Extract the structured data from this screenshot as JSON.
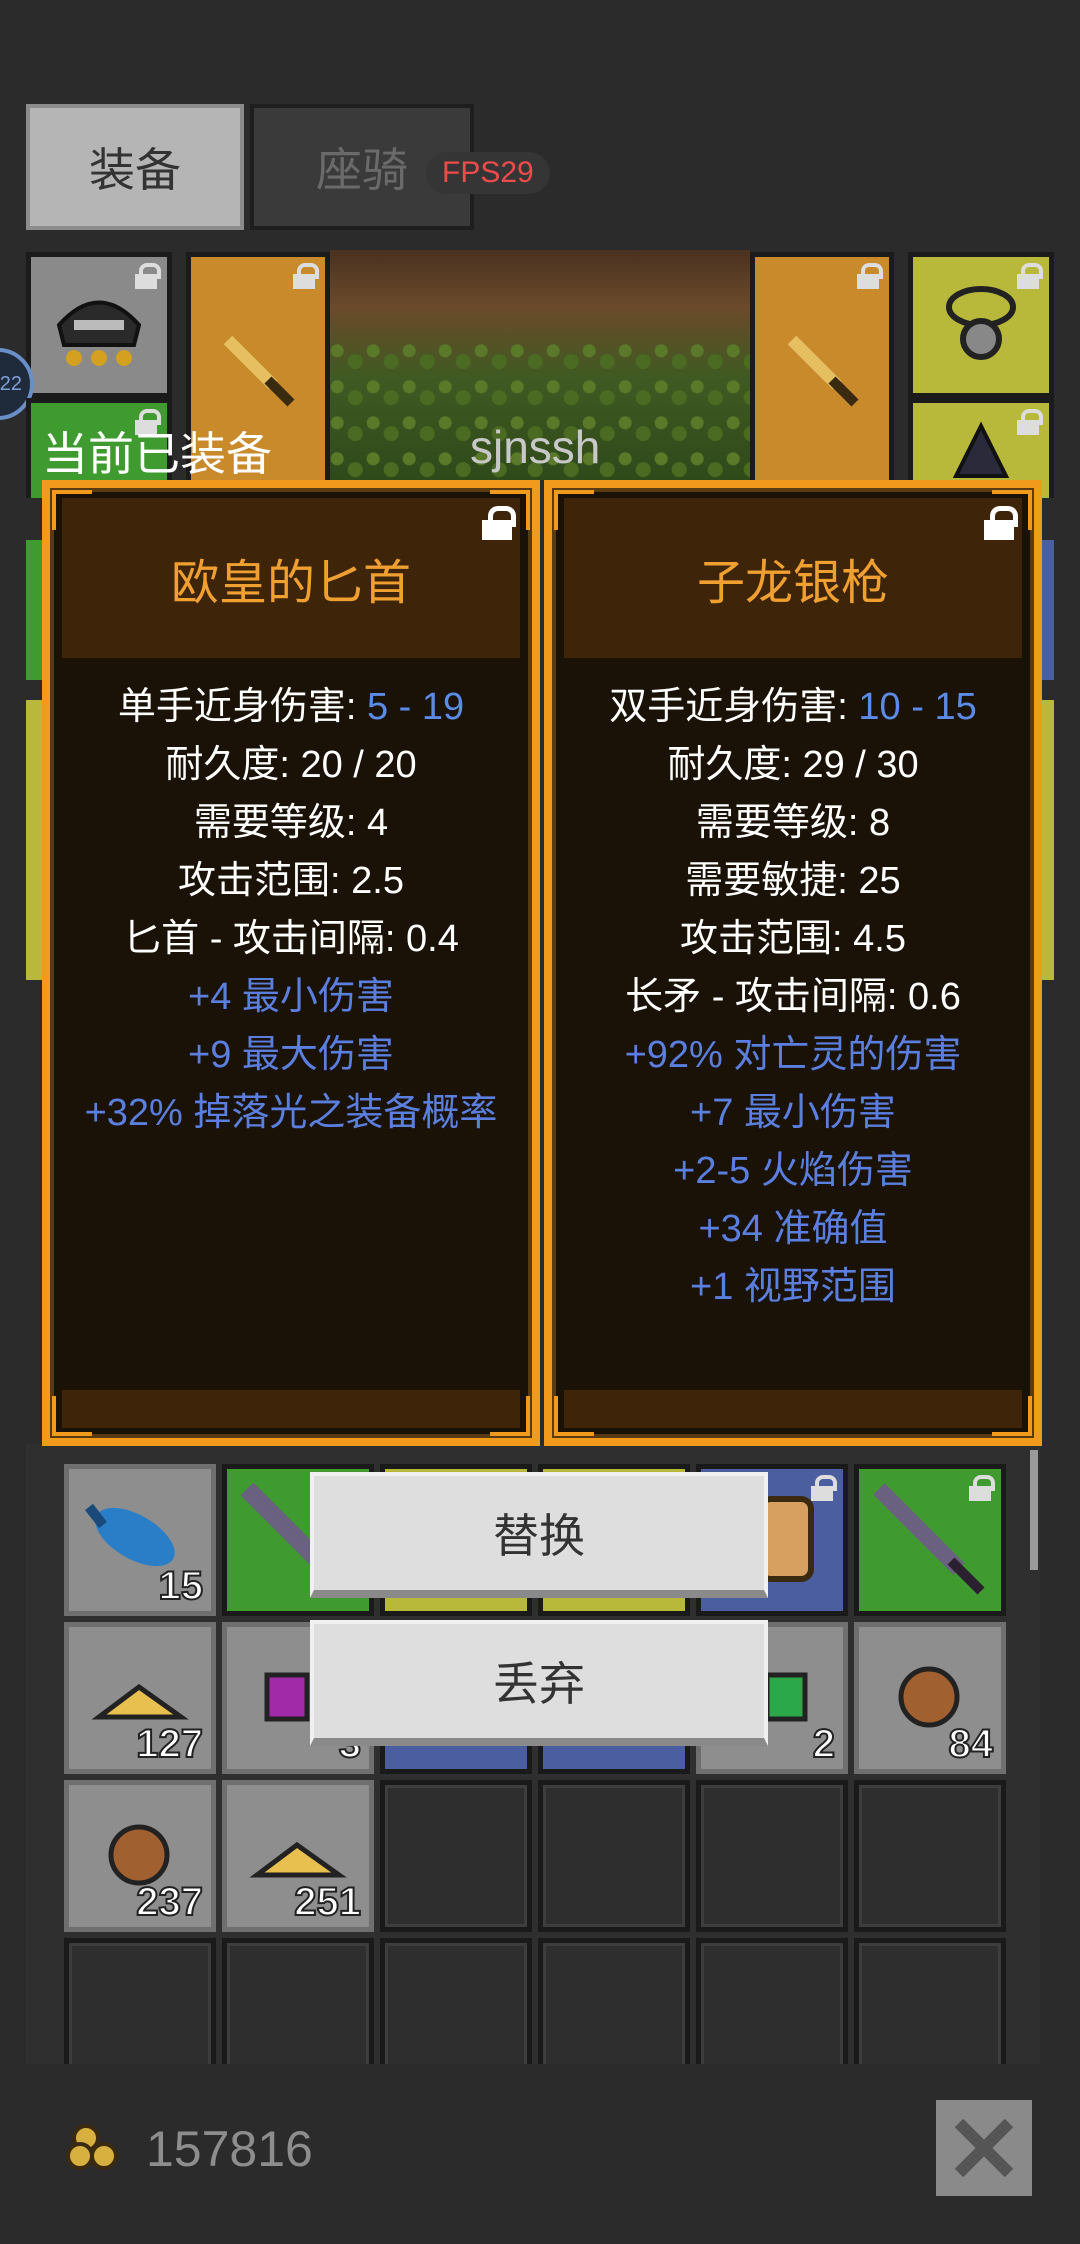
{
  "tabs": {
    "equip_label": "装备",
    "mount_label": "座骑"
  },
  "fps_badge": "FPS29",
  "side_badge": "22",
  "equipped_label": "当前已装备",
  "player_name": "sjnssh",
  "current_item": {
    "name": "欧皇的匕首",
    "stats": [
      {
        "label": "单手近身伤害: ",
        "value": "5 - 19"
      },
      {
        "label": "耐久度: 20 / 20",
        "value": ""
      },
      {
        "label": "需要等级: 4",
        "value": ""
      },
      {
        "label": "攻击范围: 2.5",
        "value": ""
      },
      {
        "label": "匕首 - 攻击间隔: 0.4",
        "value": ""
      }
    ],
    "bonuses": [
      "+4 最小伤害",
      "+9 最大伤害",
      "+32% 掉落光之装备概率"
    ]
  },
  "new_item": {
    "name": "子龙银枪",
    "stats": [
      {
        "label": "双手近身伤害: ",
        "value": "10 - 15"
      },
      {
        "label": "耐久度: 29 / 30",
        "value": ""
      },
      {
        "label": "需要等级: 8",
        "value": ""
      },
      {
        "label": "需要敏捷: 25",
        "value": ""
      },
      {
        "label": "攻击范围: 4.5",
        "value": ""
      },
      {
        "label": "长矛 - 攻击间隔: 0.6",
        "value": ""
      }
    ],
    "bonuses": [
      "+92% 对亡灵的伤害",
      "+7 最小伤害",
      "+2-5 火焰伤害",
      "+34 准确值",
      "+1 视野范围"
    ]
  },
  "actions": {
    "replace_label": "替换",
    "discard_label": "丢弃"
  },
  "inventory_counts": {
    "blue_fish": "15",
    "gold_ore_1": "127",
    "purple_gem": "3",
    "green_gem": "2",
    "copper_ore_1": "84",
    "copper_ore_2": "237",
    "gold_ore_2": "251"
  },
  "gold_amount": "157816",
  "colors": {
    "accent_orange": "#f29a1c",
    "bonus_blue": "#5b7fe0",
    "fps_red": "#f04b4b"
  }
}
